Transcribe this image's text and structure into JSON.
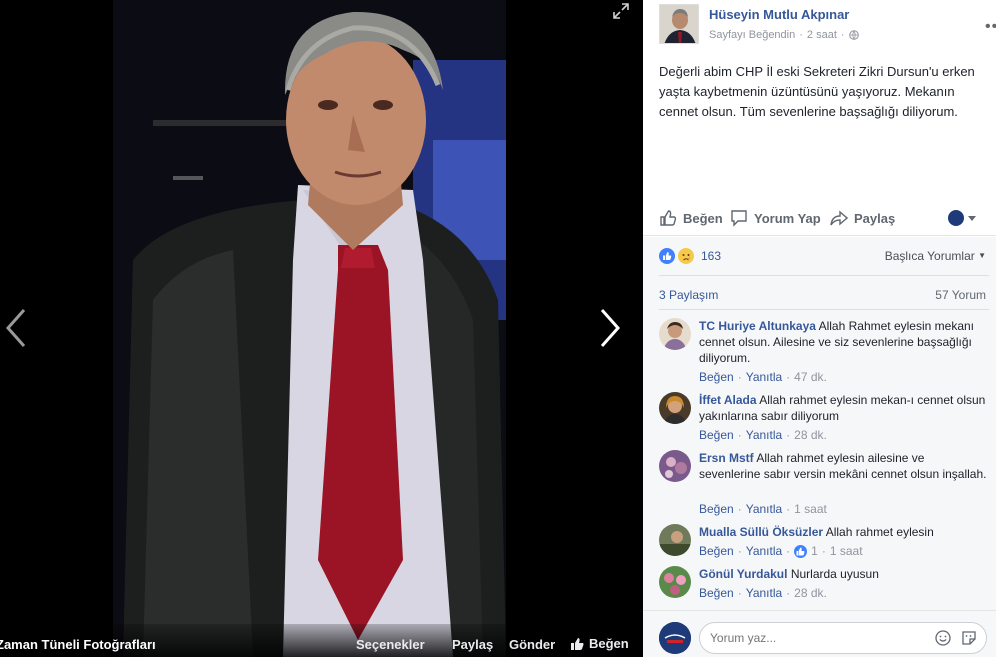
{
  "photo_viewer": {
    "album_title": "Zaman Tüneli Fotoğrafları",
    "options_label": "Seçenekler",
    "share_label": "Paylaş",
    "send_label": "Gönder",
    "like_label": "Beğen"
  },
  "post": {
    "author": "Hüseyin Mutlu Akpınar",
    "liked_page": "Sayfayı Beğendin",
    "time": "2 saat",
    "text": "Değerli abim CHP İl eski Sekreteri Zikri Dursun'u erken yaşta kaybetmenin üzüntüsünü yaşıyoruz. Mekanın cennet olsun. Tüm sevenlerine başsağlığı diliyorum."
  },
  "actions": {
    "like": "Beğen",
    "comment": "Yorum Yap",
    "share": "Paylaş"
  },
  "feedback": {
    "reaction_count": "163",
    "sort_label": "Başlıca Yorumlar",
    "share_count": "3 Paylaşım",
    "comment_count": "57 Yorum"
  },
  "comments": [
    {
      "name": "TC Huriye Altunkaya",
      "text": "Allah Rahmet eylesin mekanı cennet olsun. Ailesine ve siz sevenlerine başsağlığı diliyorum.",
      "like": "Beğen",
      "reply": "Yanıtla",
      "time": "47 dk."
    },
    {
      "name": "İffet Alada",
      "text": "Allah rahmet eylesin mekan-ı cennet olsun yakınlarına sabır diliyorum",
      "like": "Beğen",
      "reply": "Yanıtla",
      "time": "28 dk."
    },
    {
      "name": "Ersn Mstf",
      "text": "Allah rahmet eylesin ailesine ve sevenlerine sabır versin mekâni cennet olsun inşallah.",
      "like": "Beğen",
      "reply": "Yanıtla",
      "time": "1 saat"
    },
    {
      "name": "Mualla Süllü Öksüzler",
      "text": "Allah rahmet eylesin",
      "like": "Beğen",
      "reply": "Yanıtla",
      "likes": "1",
      "time": "1 saat"
    },
    {
      "name": "Gönül Yurdakul",
      "text": "Nurlarda uyusun",
      "like": "Beğen",
      "reply": "Yanıtla",
      "time": "28 dk."
    }
  ],
  "composer": {
    "placeholder": "Yorum yaz..."
  },
  "colors": {
    "link": "#365899",
    "like_blue": "#4080ff",
    "tie_red": "#9a1426"
  }
}
